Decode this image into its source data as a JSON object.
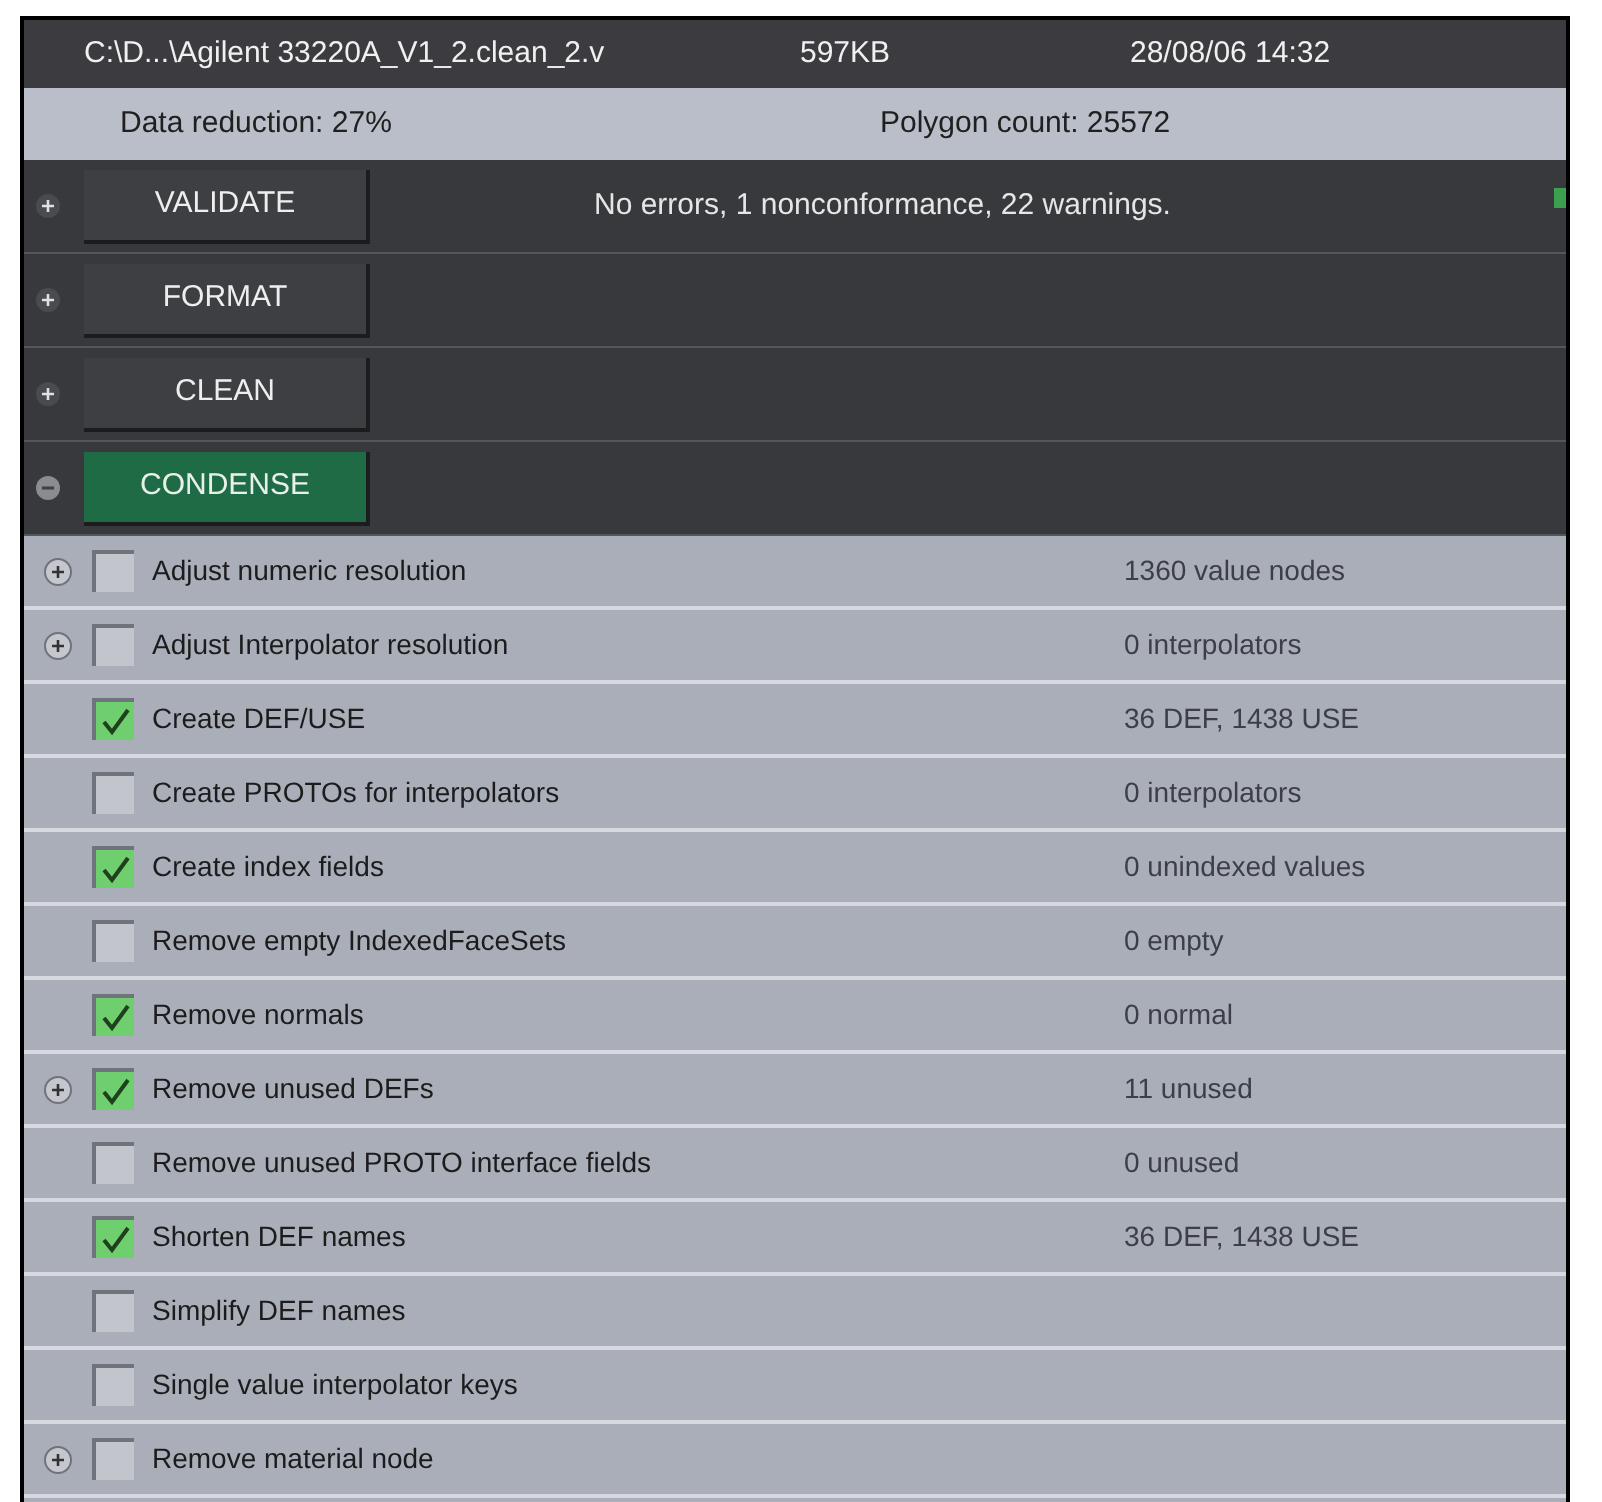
{
  "header": {
    "path": "C:\\D...\\Agilent 33220A_V1_2.clean_2.v",
    "size": "597KB",
    "date": "28/08/06 14:32"
  },
  "summary": {
    "data_reduction": "Data reduction:  27%",
    "polygon_count": "Polygon count:  25572"
  },
  "sections": [
    {
      "label": "VALIDATE",
      "expanded": false,
      "message": "No errors, 1 nonconformance, 22 warnings."
    },
    {
      "label": "FORMAT",
      "expanded": false
    },
    {
      "label": "CLEAN",
      "expanded": false
    },
    {
      "label": "CONDENSE",
      "expanded": true
    }
  ],
  "options": [
    {
      "label": "Adjust numeric resolution",
      "checked": false,
      "has_children": true,
      "result": "1360 value nodes"
    },
    {
      "label": "Adjust Interpolator resolution",
      "checked": false,
      "has_children": true,
      "result": "0 interpolators"
    },
    {
      "label": "Create DEF/USE",
      "checked": true,
      "has_children": false,
      "result": "36 DEF, 1438 USE"
    },
    {
      "label": "Create PROTOs for interpolators",
      "checked": false,
      "has_children": false,
      "result": "0 interpolators"
    },
    {
      "label": "Create index fields",
      "checked": true,
      "has_children": false,
      "result": "0 unindexed values"
    },
    {
      "label": "Remove empty IndexedFaceSets",
      "checked": false,
      "has_children": false,
      "result": "0 empty"
    },
    {
      "label": "Remove normals",
      "checked": true,
      "has_children": false,
      "result": "0 normal"
    },
    {
      "label": "Remove unused DEFs",
      "checked": true,
      "has_children": true,
      "result": "11 unused"
    },
    {
      "label": "Remove unused PROTO interface fields",
      "checked": false,
      "has_children": false,
      "result": "0 unused"
    },
    {
      "label": "Shorten DEF names",
      "checked": true,
      "has_children": false,
      "result": "36 DEF, 1438 USE"
    },
    {
      "label": "Simplify DEF names",
      "checked": false,
      "has_children": false
    },
    {
      "label": "Single value interpolator keys",
      "checked": false,
      "has_children": false
    },
    {
      "label": "Remove material node",
      "checked": false,
      "has_children": true
    }
  ]
}
